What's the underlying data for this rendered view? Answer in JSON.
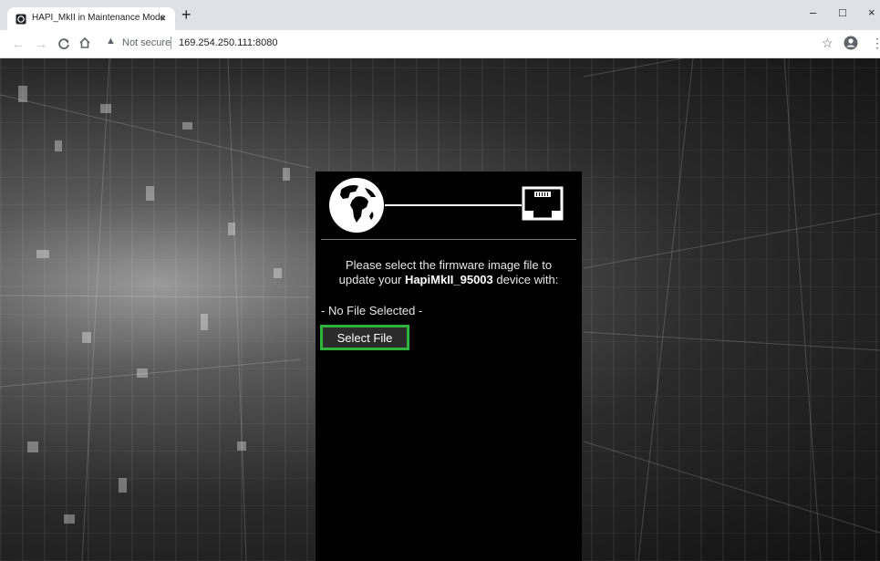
{
  "browser": {
    "tab_title": "HAPI_MkII in Maintenance Mode",
    "tab_close": "×",
    "new_tab": "+",
    "security_label": "Not secure",
    "separator": "|",
    "url": "169.254.250.111:8080",
    "window_controls": {
      "minimize": "–",
      "maximize": "□",
      "close": "×"
    },
    "nav_icons": [
      "back-icon",
      "forward-icon",
      "reload-icon",
      "home-icon"
    ],
    "toolbar_icons": [
      "star-icon",
      "profile-icon",
      "menu-icon"
    ]
  },
  "panel": {
    "header_icons": [
      "globe-icon",
      "ethernet-icon"
    ],
    "instruction_line1": "Please select the firmware image file to",
    "instruction_prefix": "update your ",
    "device_name": "HapiMkII_95003",
    "instruction_suffix": " device with:",
    "file_status": "- No File Selected -",
    "select_button_label": "Select File"
  },
  "colors": {
    "panel_bg": "#000000",
    "button_border": "#2fb33a",
    "button_bg": "#2b2b2b",
    "chrome_frame": "#dee1e6"
  }
}
